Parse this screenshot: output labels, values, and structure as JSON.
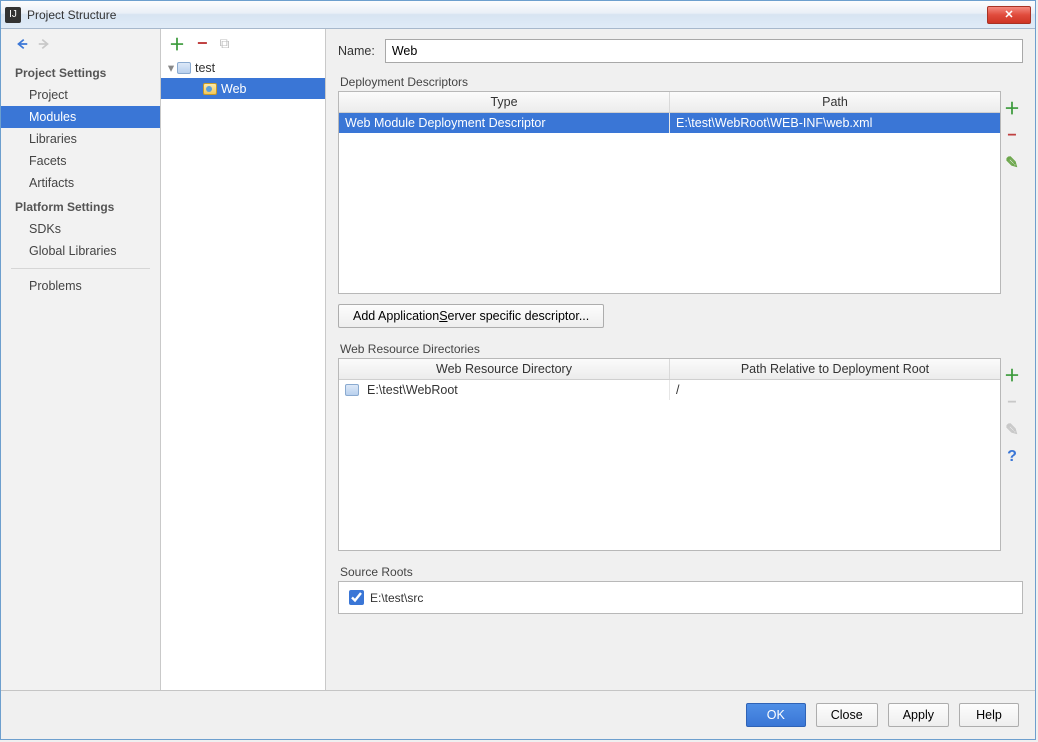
{
  "window": {
    "title": "Project Structure"
  },
  "leftnav": {
    "section1_title": "Project Settings",
    "items1": [
      "Project",
      "Modules",
      "Libraries",
      "Facets",
      "Artifacts"
    ],
    "selected1": 1,
    "section2_title": "Platform Settings",
    "items2": [
      "SDKs",
      "Global Libraries"
    ],
    "section3_items": [
      "Problems"
    ]
  },
  "tree": {
    "root": "test",
    "child": "Web"
  },
  "form": {
    "name_label": "Name:",
    "name_value": "Web"
  },
  "deploy": {
    "group_title": "Deployment Descriptors",
    "col_type": "Type",
    "col_path": "Path",
    "rows": [
      {
        "type": "Web Module Deployment Descriptor",
        "path": "E:\\test\\WebRoot\\WEB-INF\\web.xml"
      }
    ],
    "add_button_prefix": "Add Application ",
    "add_button_key": "S",
    "add_button_suffix": "erver specific descriptor..."
  },
  "resources": {
    "group_title": "Web Resource Directories",
    "col_dir": "Web Resource Directory",
    "col_rel": "Path Relative to Deployment Root",
    "rows": [
      {
        "dir": "E:\\test\\WebRoot",
        "rel": "/"
      }
    ]
  },
  "sources": {
    "group_title": "Source Roots",
    "items": [
      {
        "checked": true,
        "path": "E:\\test\\src"
      }
    ]
  },
  "footer": {
    "ok": "OK",
    "close": "Close",
    "apply": "Apply",
    "help": "Help"
  }
}
